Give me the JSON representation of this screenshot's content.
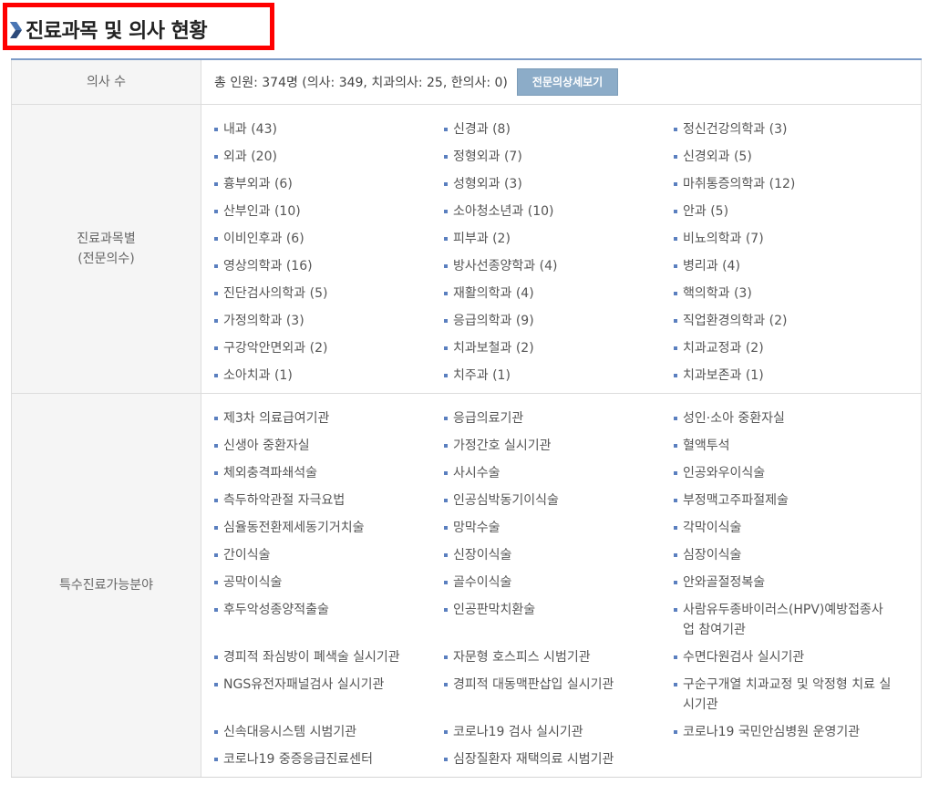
{
  "header": {
    "title": "진료과목 및 의사 현황"
  },
  "doctor_count": {
    "label": "의사 수",
    "summary": "총 인원: 374명 (의사: 349, 치과의사: 25, 한의사: 0)",
    "detail_button": "전문의상세보기"
  },
  "departments": {
    "label_line1": "진료과목별",
    "label_line2": "(전문의수)",
    "items": [
      "내과 (43)",
      "신경과 (8)",
      "정신건강의학과 (3)",
      "외과 (20)",
      "정형외과 (7)",
      "신경외과 (5)",
      "흉부외과 (6)",
      "성형외과 (3)",
      "마취통증의학과 (12)",
      "산부인과 (10)",
      "소아청소년과 (10)",
      "안과 (5)",
      "이비인후과 (6)",
      "피부과 (2)",
      "비뇨의학과 (7)",
      "영상의학과 (16)",
      "방사선종양학과 (4)",
      "병리과 (4)",
      "진단검사의학과 (5)",
      "재활의학과 (4)",
      "핵의학과 (3)",
      "가정의학과 (3)",
      "응급의학과 (9)",
      "직업환경의학과 (2)",
      "구강악안면외과 (2)",
      "치과보철과 (2)",
      "치과교정과 (2)",
      "소아치과 (1)",
      "치주과 (1)",
      "치과보존과 (1)"
    ]
  },
  "special": {
    "label": "특수진료가능분야",
    "items": [
      "제3차 의료급여기관",
      "응급의료기관",
      "성인·소아 중환자실",
      "신생아 중환자실",
      "가정간호 실시기관",
      "혈액투석",
      "체외충격파쇄석술",
      "사시수술",
      "인공와우이식술",
      "측두하악관절 자극요법",
      "인공심박동기이식술",
      "부정맥고주파절제술",
      "심율동전환제세동기거치술",
      "망막수술",
      "각막이식술",
      "간이식술",
      "신장이식술",
      "심장이식술",
      "공막이식술",
      "골수이식술",
      "안와골절정복술",
      "후두악성종양적출술",
      "인공판막치환술",
      "사람유두종바이러스(HPV)예방접종사업 참여기관",
      "경피적 좌심방이 폐색술 실시기관",
      "자문형 호스피스 시범기관",
      "수면다원검사 실시기관",
      "NGS유전자패널검사 실시기관",
      "경피적 대동맥판삽입 실시기관",
      "구순구개열 치과교정 및 악정형 치료 실시기관",
      "신속대응시스템 시범기관",
      "코로나19 검사 실시기관",
      "코로나19 국민안심병원 운영기관",
      "코로나19 중증응급진료센터",
      "심장질환자 재택의료 시범기관"
    ]
  },
  "colors": {
    "accent": "#7d9cc8",
    "highlight_border": "#ff0000",
    "button_bg": "#8cacc8",
    "bullet": "#5a7fbf"
  }
}
